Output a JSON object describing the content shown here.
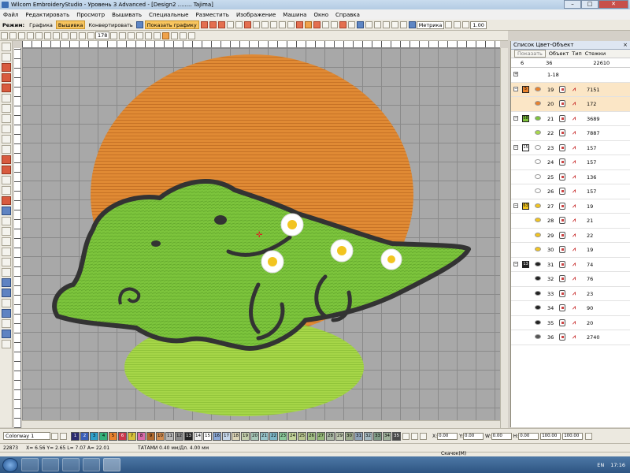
{
  "window": {
    "title": "Wilcom EmbroideryStudio - Уровень 3 Advanced - [Design2 ........ Tajima]",
    "minimize": "–",
    "maximize": "□",
    "close": "✕"
  },
  "menu": [
    "Файл",
    "Редактировать",
    "Просмотр",
    "Вышивать",
    "Специальные",
    "Разместить",
    "Изображение",
    "Машина",
    "Окно",
    "Справка"
  ],
  "toolbar": {
    "mode_label": "Режим:",
    "graphics": "Графика",
    "embroidery": "Вышивка",
    "convert": "Конвертировать",
    "show_graphics": "Показать графику",
    "units": "Метрика",
    "zoom_value": "1.00",
    "angle_value": "178"
  },
  "panel": {
    "title": "Список Цвет-Объект",
    "close": "×",
    "show_button": "Показать",
    "col_object": "Объект",
    "col_type": "Тип",
    "col_stitches": "Стежки",
    "head_left": "6",
    "head_mid": "36",
    "head_right": "22610",
    "rows": [
      {
        "swatch": "",
        "num": "1-18",
        "stitches": "",
        "color": "",
        "obj": "",
        "sel": false,
        "expander": "+"
      },
      {
        "swatch": "5",
        "num": "19",
        "stitches": "7151",
        "color": "#e8822e",
        "obj": "#e8822e",
        "sel": true,
        "expander": "−"
      },
      {
        "swatch": "",
        "num": "20",
        "stitches": "172",
        "color": "",
        "obj": "#e8822e",
        "sel": true,
        "expander": ""
      },
      {
        "swatch": "58",
        "num": "21",
        "stitches": "3689",
        "color": "#7ec33c",
        "obj": "#7ec33c",
        "sel": false,
        "expander": "−"
      },
      {
        "swatch": "",
        "num": "22",
        "stitches": "7887",
        "color": "",
        "obj": "#a8d84a",
        "sel": false,
        "expander": ""
      },
      {
        "swatch": "15",
        "num": "23",
        "stitches": "157",
        "color": "#ffffff",
        "obj": "#ffffff",
        "sel": false,
        "expander": "−"
      },
      {
        "swatch": "",
        "num": "24",
        "stitches": "157",
        "color": "",
        "obj": "#ffffff",
        "sel": false,
        "expander": ""
      },
      {
        "swatch": "",
        "num": "25",
        "stitches": "136",
        "color": "",
        "obj": "#ffffff",
        "sel": false,
        "expander": ""
      },
      {
        "swatch": "",
        "num": "26",
        "stitches": "157",
        "color": "",
        "obj": "#ffffff",
        "sel": false,
        "expander": ""
      },
      {
        "swatch": "63",
        "num": "27",
        "stitches": "19",
        "color": "#f2c420",
        "obj": "#f2c420",
        "sel": false,
        "expander": "−"
      },
      {
        "swatch": "",
        "num": "28",
        "stitches": "21",
        "color": "",
        "obj": "#f2c420",
        "sel": false,
        "expander": ""
      },
      {
        "swatch": "",
        "num": "29",
        "stitches": "22",
        "color": "",
        "obj": "#f2c420",
        "sel": false,
        "expander": ""
      },
      {
        "swatch": "",
        "num": "30",
        "stitches": "19",
        "color": "",
        "obj": "#f2c420",
        "sel": false,
        "expander": ""
      },
      {
        "swatch": "13",
        "num": "31",
        "stitches": "74",
        "color": "#222222",
        "obj": "#222222",
        "sel": false,
        "expander": "−"
      },
      {
        "swatch": "",
        "num": "32",
        "stitches": "76",
        "color": "",
        "obj": "#222222",
        "sel": false,
        "expander": ""
      },
      {
        "swatch": "",
        "num": "33",
        "stitches": "23",
        "color": "",
        "obj": "#222222",
        "sel": false,
        "expander": ""
      },
      {
        "swatch": "",
        "num": "34",
        "stitches": "90",
        "color": "",
        "obj": "#222222",
        "sel": false,
        "expander": ""
      },
      {
        "swatch": "",
        "num": "35",
        "stitches": "20",
        "color": "",
        "obj": "#222222",
        "sel": false,
        "expander": ""
      },
      {
        "swatch": "",
        "num": "36",
        "stitches": "2740",
        "color": "",
        "obj": "#555555",
        "sel": false,
        "expander": ""
      }
    ]
  },
  "bottom": {
    "colorway": "Colorway 1",
    "swatches": [
      {
        "n": "1",
        "c": "#2a2a6e"
      },
      {
        "n": "2",
        "c": "#3a5fb8"
      },
      {
        "n": "3",
        "c": "#2e9ec8"
      },
      {
        "n": "4",
        "c": "#35b07a"
      },
      {
        "n": "5",
        "c": "#e8822e"
      },
      {
        "n": "6",
        "c": "#c9374a"
      },
      {
        "n": "7",
        "c": "#d6c13a"
      },
      {
        "n": "8",
        "c": "#d86aa8"
      },
      {
        "n": "9",
        "c": "#b06a2e"
      },
      {
        "n": "10",
        "c": "#d08c50"
      },
      {
        "n": "11",
        "c": "#b7b7b7"
      },
      {
        "n": "12",
        "c": "#8a8a8a"
      },
      {
        "n": "13",
        "c": "#222222"
      },
      {
        "n": "14",
        "c": "#f0f0f0"
      },
      {
        "n": "15",
        "c": "#ffffff"
      },
      {
        "n": "16",
        "c": "#8ba8d6"
      },
      {
        "n": "17",
        "c": "#c6d7ea"
      },
      {
        "n": "18",
        "c": "#dcd5b7"
      },
      {
        "n": "19",
        "c": "#c5d0ae"
      },
      {
        "n": "20",
        "c": "#a7c8b8"
      },
      {
        "n": "21",
        "c": "#98c6cc"
      },
      {
        "n": "22",
        "c": "#7cb6c6"
      },
      {
        "n": "23",
        "c": "#8bc99a"
      },
      {
        "n": "24",
        "c": "#c5d59a"
      },
      {
        "n": "25",
        "c": "#b9c68e"
      },
      {
        "n": "26",
        "c": "#a3bf85"
      },
      {
        "n": "27",
        "c": "#95b878"
      },
      {
        "n": "28",
        "c": "#a8b6a2"
      },
      {
        "n": "29",
        "c": "#c0c9b0"
      },
      {
        "n": "30",
        "c": "#9cab8c"
      },
      {
        "n": "31",
        "c": "#8fa1b6"
      },
      {
        "n": "32",
        "c": "#a4b8c0"
      },
      {
        "n": "33",
        "c": "#7f9a86"
      },
      {
        "n": "34",
        "c": "#9eb09a"
      },
      {
        "n": "35",
        "c": "#4a4a4a"
      }
    ],
    "x_label": "X:",
    "y_label": "Y:",
    "w_label": "W:",
    "h_label": "H:",
    "x_val": "0.00",
    "y_val": "0.00",
    "w_val": "0.00",
    "h_val": "0.00",
    "pct1": "100.00",
    "pct2": "100.00"
  },
  "status": {
    "count": "22873",
    "coords": "X=   6.56 Y=   2.65 L=   7.07 A=  22.01",
    "fabric": "ТАТАМИ  0.40 мм/Дл.  4.00 мм",
    "download": "Скачок(М)"
  },
  "taskbar": {
    "lang": "EN",
    "time": "17:16"
  }
}
